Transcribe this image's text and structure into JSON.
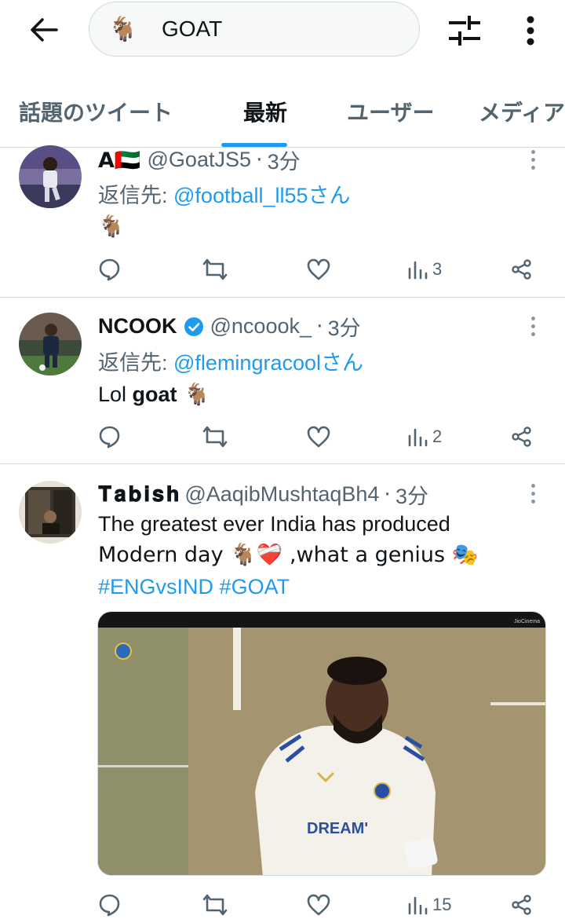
{
  "search": {
    "emoji": "🐐",
    "query": "GOAT"
  },
  "tabs": [
    {
      "label": "話題のツイート"
    },
    {
      "label": "最新"
    },
    {
      "label": "ユーザー"
    },
    {
      "label": "メディア"
    }
  ],
  "tweets": [
    {
      "name": "A🇦🇪",
      "handle": "@GoatJS5",
      "time": "3分",
      "reply_prefix": "返信先: ",
      "reply_to": "@football_ll55",
      "reply_suffix": "さん",
      "text": "🐐",
      "views": "3"
    },
    {
      "name": "NCOOK",
      "verified": true,
      "handle": "@ncoook_",
      "time": "3分",
      "reply_prefix": "返信先: ",
      "reply_to": "@flemingracool",
      "reply_suffix": "さん",
      "text_pre": "Lol ",
      "text_bold": "goat",
      "text_post": " 🐐",
      "views": "2"
    },
    {
      "name": "𝐓𝐚𝐛𝐢𝐬𝐡",
      "handle": "@AaqibMushtaqBh4",
      "time": "3分",
      "line1": "The greatest ever India has produced",
      "line2": "Modern day 🐐❤️‍🩹 ,what a genius 🎭",
      "hashtag1": "#ENGvsIND",
      "hashtag2": "#GOAT",
      "media_watermark": "JioCinema",
      "jersey_text": "DREAM'",
      "views": "15"
    }
  ],
  "colors": {
    "accent": "#1d9bf0",
    "secondary_text": "#536471",
    "divider": "#cfd9de"
  }
}
